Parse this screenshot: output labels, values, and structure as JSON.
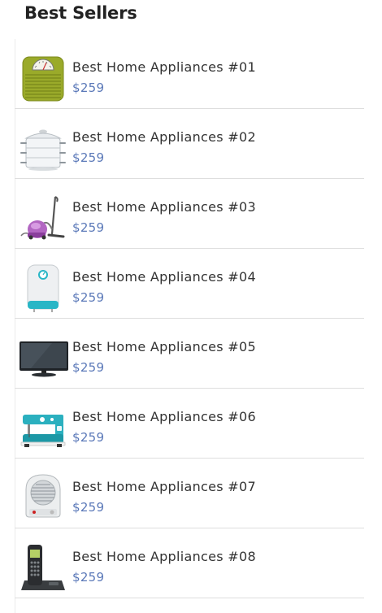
{
  "section": {
    "title": "Best Sellers"
  },
  "products": [
    {
      "name": "Best Home Appliances #01",
      "price": "$259",
      "icon": "bathroom-scale-icon"
    },
    {
      "name": "Best Home Appliances #02",
      "price": "$259",
      "icon": "steamer-pot-icon"
    },
    {
      "name": "Best Home Appliances #03",
      "price": "$259",
      "icon": "vacuum-cleaner-icon"
    },
    {
      "name": "Best Home Appliances #04",
      "price": "$259",
      "icon": "water-heater-icon"
    },
    {
      "name": "Best Home Appliances #05",
      "price": "$259",
      "icon": "tv-monitor-icon"
    },
    {
      "name": "Best Home Appliances #06",
      "price": "$259",
      "icon": "sewing-machine-icon"
    },
    {
      "name": "Best Home Appliances #07",
      "price": "$259",
      "icon": "fan-heater-icon"
    },
    {
      "name": "Best Home Appliances #08",
      "price": "$259",
      "icon": "cordless-phone-icon"
    }
  ]
}
